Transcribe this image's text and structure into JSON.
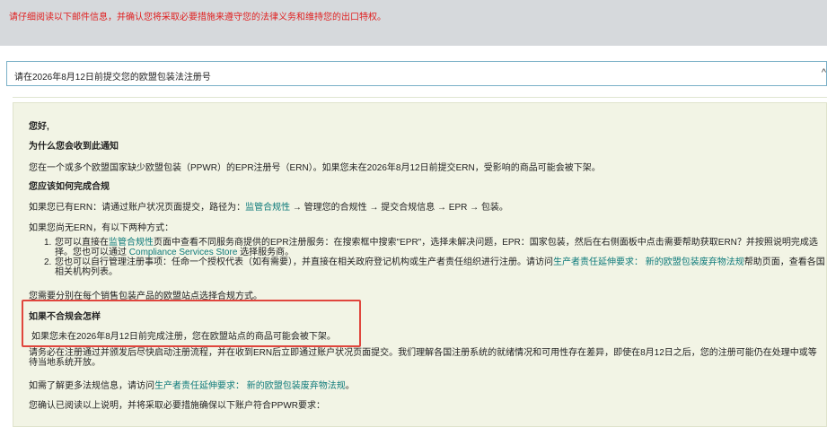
{
  "banner": {
    "warning": "请仔细阅读以下邮件信息，并确认您将采取必要措施来遵守您的法律义务和维持您的出口特权。"
  },
  "subject": {
    "text": "请在2026年8月12日前提交您的欧盟包装法注册号",
    "caret": "^"
  },
  "message": {
    "greeting": "您好,",
    "why_heading": "为什么您会收到此通知",
    "why_body": "您在一个或多个欧盟国家缺少欧盟包装（PPWR）的EPR注册号（ERN）。如果您未在2026年8月12日前提交ERN，受影响的商品可能会被下架。",
    "how_heading": "您应该如何完成合规",
    "has_ern_prefix": "如果您已有ERN：请通过账户状况页面提交，路径为：",
    "has_ern_link": "监管合规性",
    "has_ern_suffix": " → 管理您的合规性 → 提交合规信息 → EPR → 包装。",
    "no_ern_intro": "如果您尚无ERN，有以下两种方式：",
    "opt1_num": "1.",
    "opt1_prefix": "您可以直接在",
    "opt1_link": "监管合规性",
    "opt1_mid": "页面中查看不同服务商提供的EPR注册服务：在搜索框中搜索\"EPR\"，选择未解决问题，EPR：国家包装，然后在右侧面板中点击需要帮助获取ERN？并按照说明完成选择。您也可以通过 ",
    "opt1_link2": "Compliance Services Store",
    "opt1_suffix": " 选择服务商。",
    "opt2_num": "2.",
    "opt2_prefix": "您也可以自行管理注册事项：任命一个授权代表（如有需要），并直接在相关政府登记机构或生产者责任组织进行注册。请访问",
    "opt2_link": "生产者责任延伸要求：  新的欧盟包装废弃物法规",
    "opt2_suffix": "帮助页面，查看各国相关机构列表。",
    "per_site": "您需要分别在每个销售包装产品的欧盟站点选择合规方式。",
    "noncompliance_heading": "如果不合规会怎样",
    "noncompliance_body": "如果您未在2026年8月12日前完成注册，您在欧盟站点的商品可能会被下架。",
    "delay_note": "请务必在注册通过并颁发后尽快启动注册流程，并在收到ERN后立即通过账户状况页面提交。我们理解各国注册系统的就绪情况和可用性存在差异，即使在8月12日之后，您的注册可能仍在处理中或等待当地系统开放。",
    "more_info_prefix": "如需了解更多法规信息，请访问",
    "more_info_link": "生产者责任延伸要求：  新的欧盟包装废弃物法规",
    "more_info_suffix": "。",
    "confirm": "您确认已阅读以上说明，并将采取必要措施确保以下账户符合PPWR要求："
  },
  "colors": {
    "warning_red": "#e02020",
    "link_teal": "#0e7a7a",
    "highlight_border": "#e0463d",
    "panel_bg": "#f2f4e5"
  }
}
